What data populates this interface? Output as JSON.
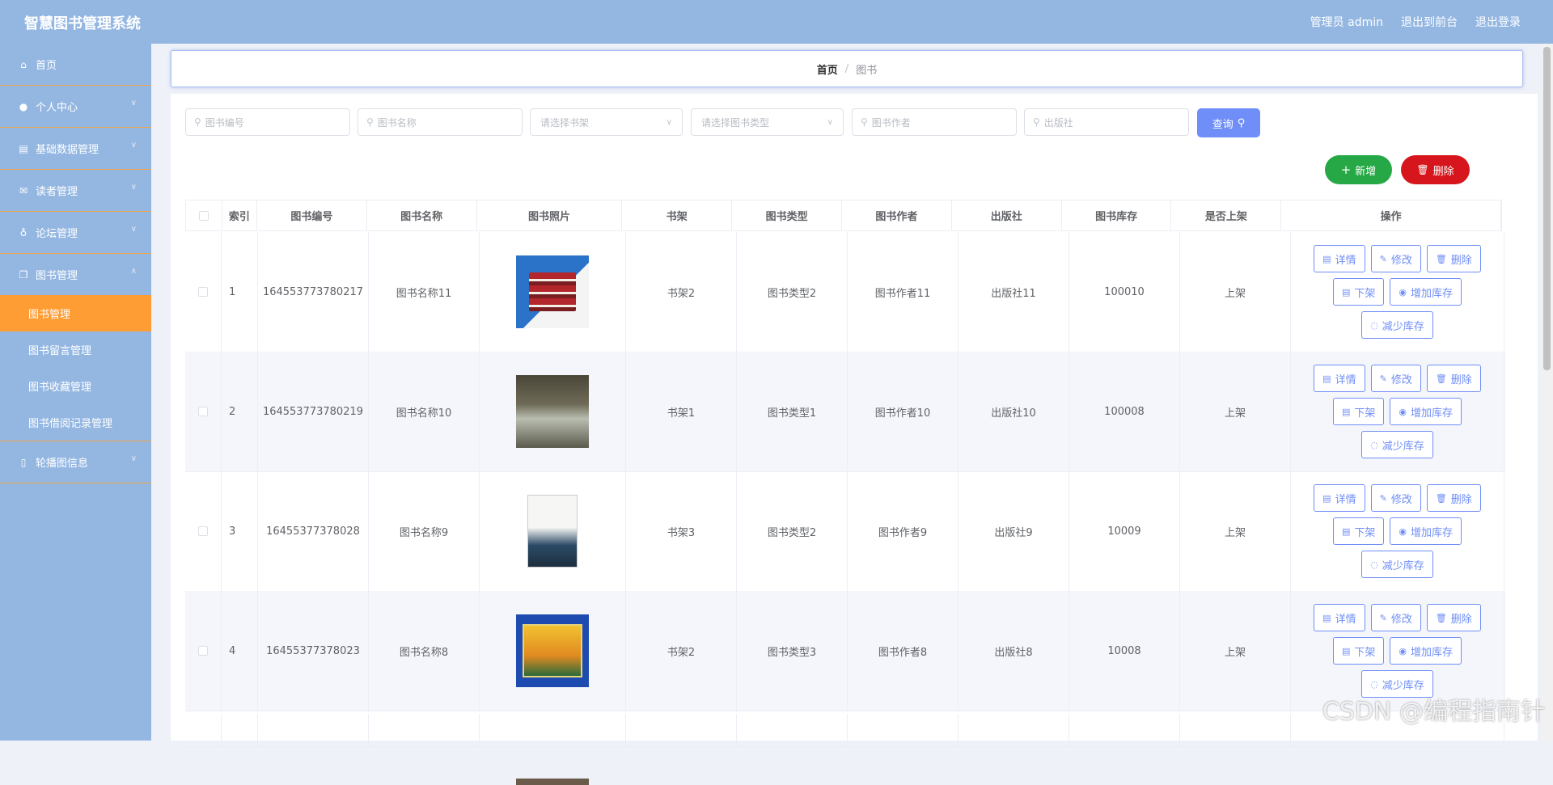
{
  "app": {
    "title": "智慧图书管理系统"
  },
  "header": {
    "admin_label": "管理员 admin",
    "front_label": "退出到前台",
    "logout_label": "退出登录"
  },
  "sidebar": {
    "items": [
      {
        "label": "首页",
        "icon": "home-icon"
      },
      {
        "label": "个人中心",
        "icon": "user-icon"
      },
      {
        "label": "基础数据管理",
        "icon": "clipboard-icon"
      },
      {
        "label": "读者管理",
        "icon": "mail-icon"
      },
      {
        "label": "论坛管理",
        "icon": "microphone-icon"
      },
      {
        "label": "图书管理",
        "icon": "copy-icon"
      }
    ],
    "subitems": [
      {
        "label": "图书管理",
        "active": true
      },
      {
        "label": "图书留言管理",
        "active": false
      },
      {
        "label": "图书收藏管理",
        "active": false
      },
      {
        "label": "图书借阅记录管理",
        "active": false
      }
    ],
    "last_item": {
      "label": "轮播图信息",
      "icon": "phone-icon"
    }
  },
  "breadcrumb": {
    "home": "首页",
    "current": "图书"
  },
  "search": {
    "book_no_placeholder": "图书编号",
    "book_name_placeholder": "图书名称",
    "shelf_placeholder": "请选择书架",
    "type_placeholder": "请选择图书类型",
    "author_placeholder": "图书作者",
    "publisher_placeholder": "出版社",
    "query_label": "查询"
  },
  "actions": {
    "add_label": "新增",
    "delete_label": "删除"
  },
  "table": {
    "columns": [
      "索引",
      "图书编号",
      "图书名称",
      "图书照片",
      "书架",
      "图书类型",
      "图书作者",
      "出版社",
      "图书库存",
      "是否上架",
      "操作"
    ],
    "op_labels": {
      "detail": "详情",
      "edit": "修改",
      "delete": "删除",
      "offshelf": "下架",
      "add_stock": "增加库存",
      "reduce_stock": "减少库存"
    },
    "rows": [
      {
        "index": "1",
        "book_no": "164553773780217",
        "name": "图书名称11",
        "shelf": "书架2",
        "type": "图书类型2",
        "author": "图书作者11",
        "publisher": "出版社11",
        "stock": "100010",
        "status": "上架"
      },
      {
        "index": "2",
        "book_no": "164553773780219",
        "name": "图书名称10",
        "shelf": "书架1",
        "type": "图书类型1",
        "author": "图书作者10",
        "publisher": "出版社10",
        "stock": "100008",
        "status": "上架"
      },
      {
        "index": "3",
        "book_no": "16455377378028",
        "name": "图书名称9",
        "shelf": "书架3",
        "type": "图书类型2",
        "author": "图书作者9",
        "publisher": "出版社9",
        "stock": "10009",
        "status": "上架"
      },
      {
        "index": "4",
        "book_no": "16455377378023",
        "name": "图书名称8",
        "shelf": "书架2",
        "type": "图书类型3",
        "author": "图书作者8",
        "publisher": "出版社8",
        "stock": "10008",
        "status": "上架"
      }
    ]
  },
  "watermark": "CSDN @编程指南针",
  "colors": {
    "header_bg": "#94b7e2",
    "active_menu": "#ff9d35",
    "primary": "#6f8ef7",
    "success": "#27a846",
    "danger": "#d6161c"
  }
}
